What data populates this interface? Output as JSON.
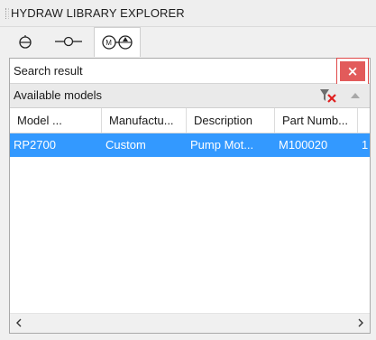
{
  "window": {
    "title": "HYDRAW LIBRARY EXPLORER"
  },
  "tabs": [
    {
      "icon": "component-symbol-icon",
      "active": false
    },
    {
      "icon": "connector-line-icon",
      "active": false
    },
    {
      "icon": "pump-motor-icon",
      "active": true
    }
  ],
  "search": {
    "label": "Search result",
    "close_label": "×"
  },
  "models": {
    "label": "Available models"
  },
  "grid": {
    "columns": [
      "Model ...",
      "Manufactu...",
      "Description",
      "Part Numb..."
    ],
    "rows": [
      {
        "model": "RP2700",
        "manufacturer": "Custom",
        "description": "Pump Mot...",
        "part_number": "M100020",
        "overflow": "1"
      }
    ]
  },
  "colors": {
    "selection": "#3399ff",
    "close_button": "#e25b5b",
    "close_border": "#e04848"
  }
}
